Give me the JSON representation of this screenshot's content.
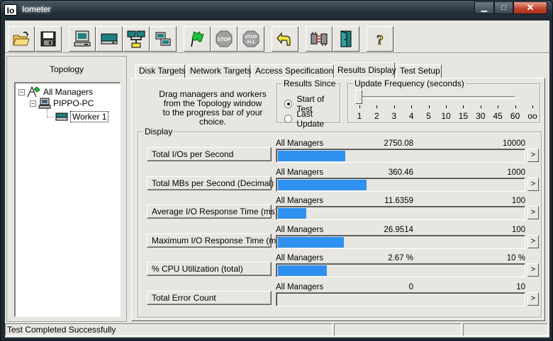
{
  "window": {
    "app_icon_text": "Io",
    "title": "Iometer",
    "minimize_glyph": "▁",
    "maximize_glyph": "□",
    "close_glyph": "✕"
  },
  "toolbar": {
    "buttons": [
      {
        "icon": "open-folder-icon"
      },
      {
        "icon": "save-disk-icon"
      },
      {
        "icon": "new-manager-icon"
      },
      {
        "icon": "new-disk-worker-icon"
      },
      {
        "icon": "new-network-worker-icon"
      },
      {
        "icon": "duplicate-worker-icon"
      },
      {
        "icon": "start-flag-icon"
      },
      {
        "icon": "stop-icon",
        "label": "STOP"
      },
      {
        "icon": "stop-all-icon",
        "label": "STOP ALL"
      },
      {
        "icon": "reset-workers-icon"
      },
      {
        "icon": "disconnect-icon"
      },
      {
        "icon": "exit-door-icon"
      },
      {
        "icon": "help-icon",
        "label": "?"
      }
    ]
  },
  "topology": {
    "title": "Topology",
    "items": [
      {
        "label": "All Managers",
        "expander": "−",
        "icon": "all-managers-icon"
      },
      {
        "label": "PIPPO-PC",
        "expander": "−",
        "icon": "manager-computer-icon"
      },
      {
        "label": "Worker 1",
        "icon": "worker-disk-icon"
      }
    ]
  },
  "tabs": [
    {
      "label": "Disk Targets"
    },
    {
      "label": "Network Targets"
    },
    {
      "label": "Access Specifications"
    },
    {
      "label": "Results Display"
    },
    {
      "label": "Test Setup"
    }
  ],
  "active_tab": "Results Display",
  "instructions": {
    "line1": "Drag managers and workers",
    "line2": "from the Topology window",
    "line3": "to the progress bar of your choice."
  },
  "results_since": {
    "label": "Results Since",
    "options": [
      {
        "label": "Start of Test",
        "selected": true
      },
      {
        "label": "Last Update",
        "selected": false
      }
    ]
  },
  "update_frequency": {
    "label": "Update Frequency (seconds)",
    "ticks": [
      "1",
      "2",
      "3",
      "4",
      "5",
      "10",
      "15",
      "30",
      "45",
      "60",
      "oo"
    ],
    "selected": "1"
  },
  "display": {
    "label": "Display",
    "rows": [
      {
        "metric": "Total I/Os per Second",
        "manager": "All Managers",
        "value": "2750.08",
        "max": "10000",
        "fill_fraction": 0.275
      },
      {
        "metric": "Total MBs per Second (Decimal)",
        "manager": "All Managers",
        "value": "360.46",
        "max": "1000",
        "fill_fraction": 0.36
      },
      {
        "metric": "Average I/O Response Time (ms)",
        "manager": "All Managers",
        "value": "11.6359",
        "max": "100",
        "fill_fraction": 0.116
      },
      {
        "metric": "Maximum I/O Response Time (ms)",
        "manager": "All Managers",
        "value": "26.9514",
        "max": "100",
        "fill_fraction": 0.27
      },
      {
        "metric": "% CPU Utilization (total)",
        "manager": "All Managers",
        "value": "2.67 %",
        "max": "10 %",
        "fill_fraction": 0.2
      },
      {
        "metric": "Total Error Count",
        "manager": "All Managers",
        "value": "0",
        "max": "10",
        "fill_fraction": 0
      }
    ],
    "arrow_glyph": ">"
  },
  "status": {
    "text": "Test Completed Successfully"
  },
  "colors": {
    "bar": "#2e90ef"
  }
}
